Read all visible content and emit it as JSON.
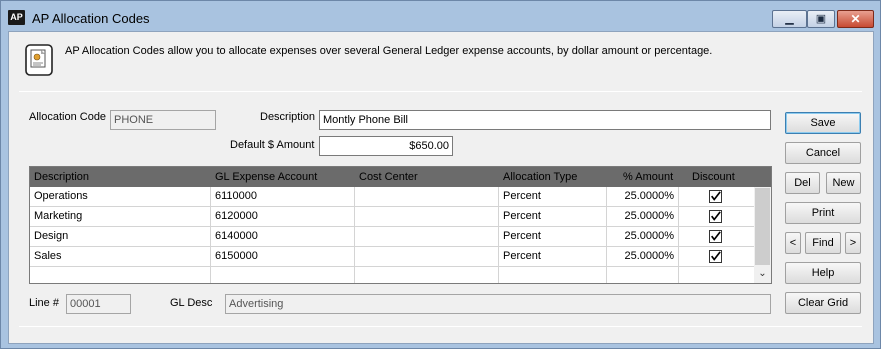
{
  "window": {
    "app_icon_text": "AP",
    "title": "AP Allocation Codes",
    "min_glyph": "▁",
    "max_glyph": "▣",
    "close_glyph": "✕"
  },
  "info": {
    "icon": "document-info-icon",
    "text": "AP Allocation Codes allow you to allocate expenses over several General Ledger expense accounts, by dollar amount or percentage."
  },
  "form": {
    "allocation_code_label": "Allocation Code",
    "allocation_code_value": "PHONE",
    "description_label": "Description",
    "description_value": "Montly Phone Bill",
    "default_amount_label": "Default $ Amount",
    "default_amount_value": "$650.00"
  },
  "grid": {
    "columns": [
      "Description",
      "GL Expense Account",
      "Cost Center",
      "Allocation Type",
      "% Amount",
      "Discount"
    ],
    "rows": [
      {
        "description": "Operations",
        "gl_account": "6110000",
        "cost_center": "",
        "allocation_type": "Percent",
        "amount": "25.0000%",
        "discount": true
      },
      {
        "description": "Marketing",
        "gl_account": "6120000",
        "cost_center": "",
        "allocation_type": "Percent",
        "amount": "25.0000%",
        "discount": true
      },
      {
        "description": "Design",
        "gl_account": "6140000",
        "cost_center": "",
        "allocation_type": "Percent",
        "amount": "25.0000%",
        "discount": true
      },
      {
        "description": "Sales",
        "gl_account": "6150000",
        "cost_center": "",
        "allocation_type": "Percent",
        "amount": "25.0000%",
        "discount": true
      },
      {
        "description": "",
        "gl_account": "",
        "cost_center": "",
        "allocation_type": "",
        "amount": "",
        "discount": false
      }
    ],
    "scroll_down_glyph": "⌄"
  },
  "footer": {
    "line_label": "Line #",
    "line_value": "00001",
    "gl_desc_label": "GL Desc",
    "gl_desc_value": "Advertising"
  },
  "buttons": {
    "save": "Save",
    "cancel": "Cancel",
    "del": "Del",
    "new": "New",
    "print": "Print",
    "prev": "<",
    "find": "Find",
    "next": ">",
    "help": "Help",
    "clear_grid": "Clear Grid"
  },
  "colors": {
    "title_bar": "#a9c3e0",
    "client_bg": "#f0f0f0",
    "grid_header": "#6b6b6b",
    "close_button": "#c74a32"
  }
}
